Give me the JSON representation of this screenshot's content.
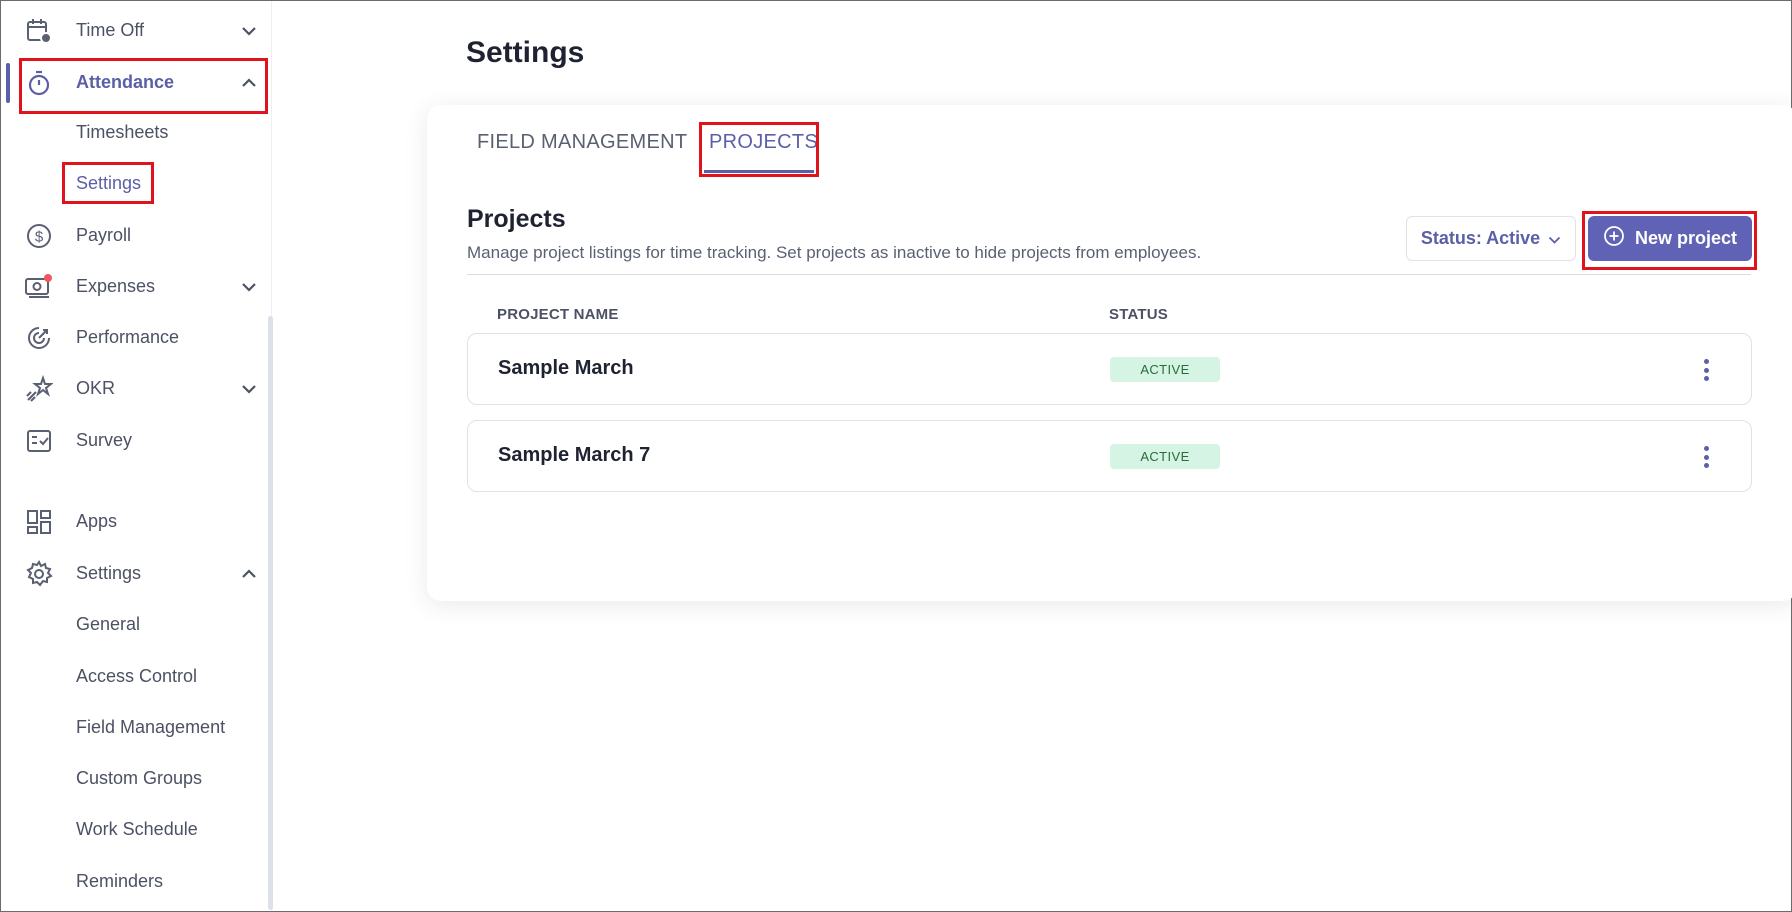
{
  "sidebar": {
    "items": [
      {
        "label": "Time Off",
        "icon": "calendar-clock-icon"
      },
      {
        "label": "Attendance",
        "icon": "stopwatch-icon"
      },
      {
        "label": "Payroll",
        "icon": "dollar-circle-icon"
      },
      {
        "label": "Expenses",
        "icon": "receipt-money-icon"
      },
      {
        "label": "Performance",
        "icon": "target-growth-icon"
      },
      {
        "label": "OKR",
        "icon": "rocket-star-icon"
      },
      {
        "label": "Survey",
        "icon": "checklist-icon"
      },
      {
        "label": "Apps",
        "icon": "apps-grid-icon"
      },
      {
        "label": "Settings",
        "icon": "gear-icon"
      }
    ],
    "attendance_sub": [
      "Timesheets",
      "Settings"
    ],
    "settings_sub": [
      "General",
      "Access Control",
      "Field Management",
      "Custom Groups",
      "Work Schedule",
      "Reminders"
    ]
  },
  "main": {
    "page_title": "Settings",
    "tabs": [
      {
        "label": "FIELD MANAGEMENT"
      },
      {
        "label": "PROJECTS"
      }
    ],
    "section_title": "Projects",
    "section_description": "Manage project listings for time tracking. Set projects as inactive to hide projects from employees.",
    "status_filter": "Status: Active",
    "new_project_label": "New project",
    "columns": [
      "PROJECT NAME",
      "STATUS"
    ],
    "rows": [
      {
        "name": "Sample March",
        "status": "ACTIVE"
      },
      {
        "name": "Sample March 7",
        "status": "ACTIVE"
      }
    ]
  },
  "colors": {
    "accent": "#5b5fa8",
    "button": "#6063b5",
    "highlight": "#e0121b",
    "badge_bg": "#d5f4e4"
  }
}
